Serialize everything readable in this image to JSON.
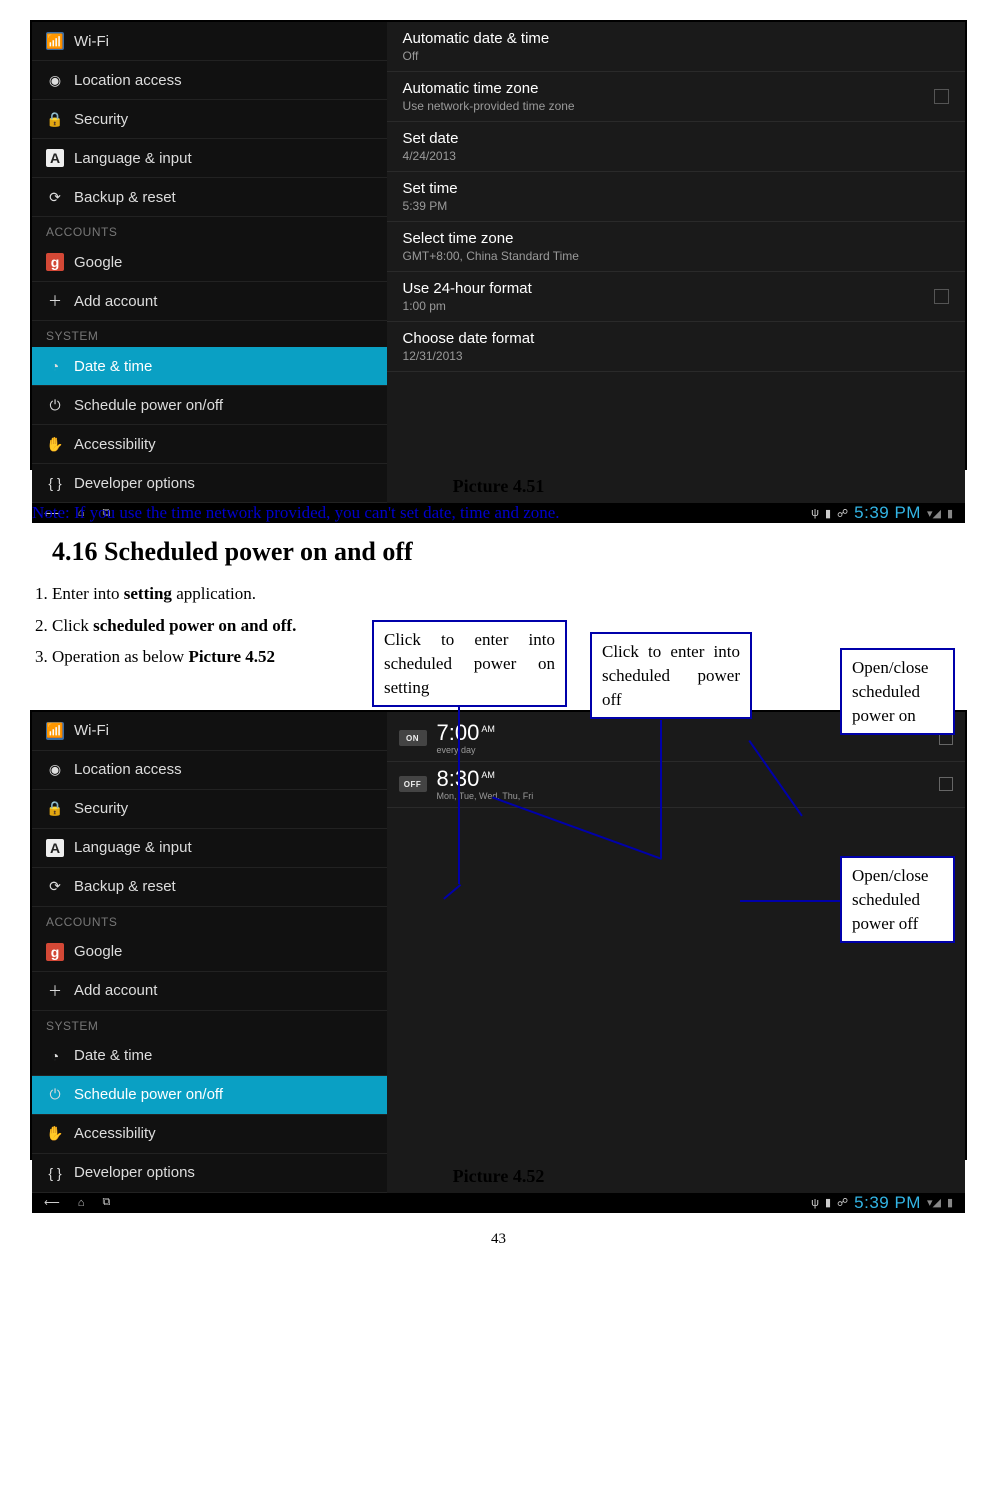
{
  "screenshot1": {
    "sidebar": {
      "items_top": [
        {
          "icon": "wifi",
          "label": "Wi-Fi"
        },
        {
          "icon": "loc",
          "label": "Location access"
        },
        {
          "icon": "lock",
          "label": "Security"
        },
        {
          "icon": "A",
          "label": "Language & input"
        },
        {
          "icon": "backup",
          "label": "Backup & reset"
        }
      ],
      "header1": "ACCOUNTS",
      "items_acc": [
        {
          "icon": "g",
          "label": "Google"
        },
        {
          "icon": "plus",
          "label": "Add account"
        }
      ],
      "header2": "SYSTEM",
      "items_sys": [
        {
          "icon": "clock",
          "label": "Date & time",
          "sel": true
        },
        {
          "icon": "power",
          "label": "Schedule power on/off"
        },
        {
          "icon": "hand",
          "label": "Accessibility"
        },
        {
          "icon": "braces",
          "label": "Developer options"
        }
      ]
    },
    "content": [
      {
        "title": "Automatic date & time",
        "sub": "Off"
      },
      {
        "title": "Automatic time zone",
        "sub": "Use network-provided time zone",
        "chk": true
      },
      {
        "title": "Set date",
        "sub": "4/24/2013"
      },
      {
        "title": "Set time",
        "sub": "5:39 PM"
      },
      {
        "title": "Select time zone",
        "sub": "GMT+8:00, China Standard Time"
      },
      {
        "title": "Use 24-hour format",
        "sub": "1:00 pm",
        "chk": true
      },
      {
        "title": "Choose date format",
        "sub": "12/31/2013"
      }
    ],
    "clock": "5:39 PM"
  },
  "caption1": "Picture 4.51",
  "note": "Note: If you use the time network provided, you can't set date, time and zone.",
  "section": "4.16 Scheduled power on and off",
  "steps": [
    {
      "pre": "Enter into ",
      "b": "setting",
      "post": " application."
    },
    {
      "pre": "Click ",
      "b": "scheduled power on and off.",
      "post": ""
    },
    {
      "pre": "Operation as below ",
      "b": "Picture 4.52",
      "post": ""
    }
  ],
  "callouts": {
    "c1": "Click to enter into scheduled power on setting",
    "c2": "Click to enter into scheduled power off",
    "c3": "Open/close scheduled power on",
    "c4": "Open/close scheduled power off"
  },
  "screenshot2": {
    "sidebar": {
      "items_top": [
        {
          "icon": "wifi",
          "label": "Wi-Fi"
        },
        {
          "icon": "loc",
          "label": "Location access"
        },
        {
          "icon": "lock",
          "label": "Security"
        },
        {
          "icon": "A",
          "label": "Language & input"
        },
        {
          "icon": "backup",
          "label": "Backup & reset"
        }
      ],
      "header1": "ACCOUNTS",
      "items_acc": [
        {
          "icon": "g",
          "label": "Google"
        },
        {
          "icon": "plus",
          "label": "Add account"
        }
      ],
      "header2": "SYSTEM",
      "items_sys": [
        {
          "icon": "clock",
          "label": "Date & time"
        },
        {
          "icon": "power",
          "label": "Schedule power on/off",
          "sel": true
        },
        {
          "icon": "hand",
          "label": "Accessibility"
        },
        {
          "icon": "braces",
          "label": "Developer options"
        }
      ]
    },
    "sched": [
      {
        "badge": "ON",
        "time": "7:00",
        "ampm": "AM",
        "days": "every day"
      },
      {
        "badge": "OFF",
        "time": "8:30",
        "ampm": "AM",
        "days": "Mon, Tue, Wed, Thu, Fri"
      }
    ],
    "clock": "5:39 PM"
  },
  "caption2": "Picture 4.52",
  "page_num": "43"
}
